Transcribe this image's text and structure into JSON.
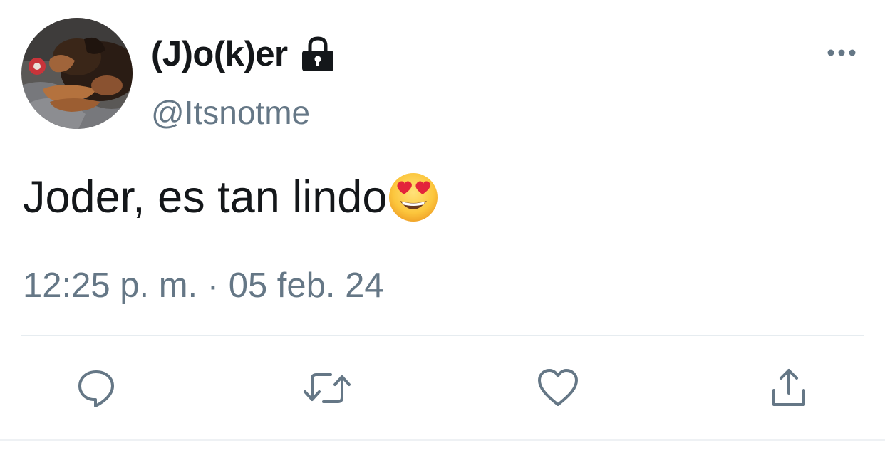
{
  "user": {
    "display_name": "(J)o(k)er",
    "handle": "@Itsnotme",
    "protected": true,
    "avatar_description": "dog-avatar"
  },
  "tweet": {
    "text": "Joder, es tan lindo",
    "emoji": "smiling-face-with-heart-eyes",
    "timestamp": "12:25 p. m. · 05 feb. 24"
  },
  "actions": [
    {
      "name": "reply",
      "icon": "reply-icon"
    },
    {
      "name": "retweet",
      "icon": "retweet-icon"
    },
    {
      "name": "like",
      "icon": "heart-icon"
    },
    {
      "name": "share",
      "icon": "share-icon"
    }
  ],
  "colors": {
    "text_primary": "#14171a",
    "text_secondary": "#657786",
    "divider": "#e6ecf0"
  }
}
